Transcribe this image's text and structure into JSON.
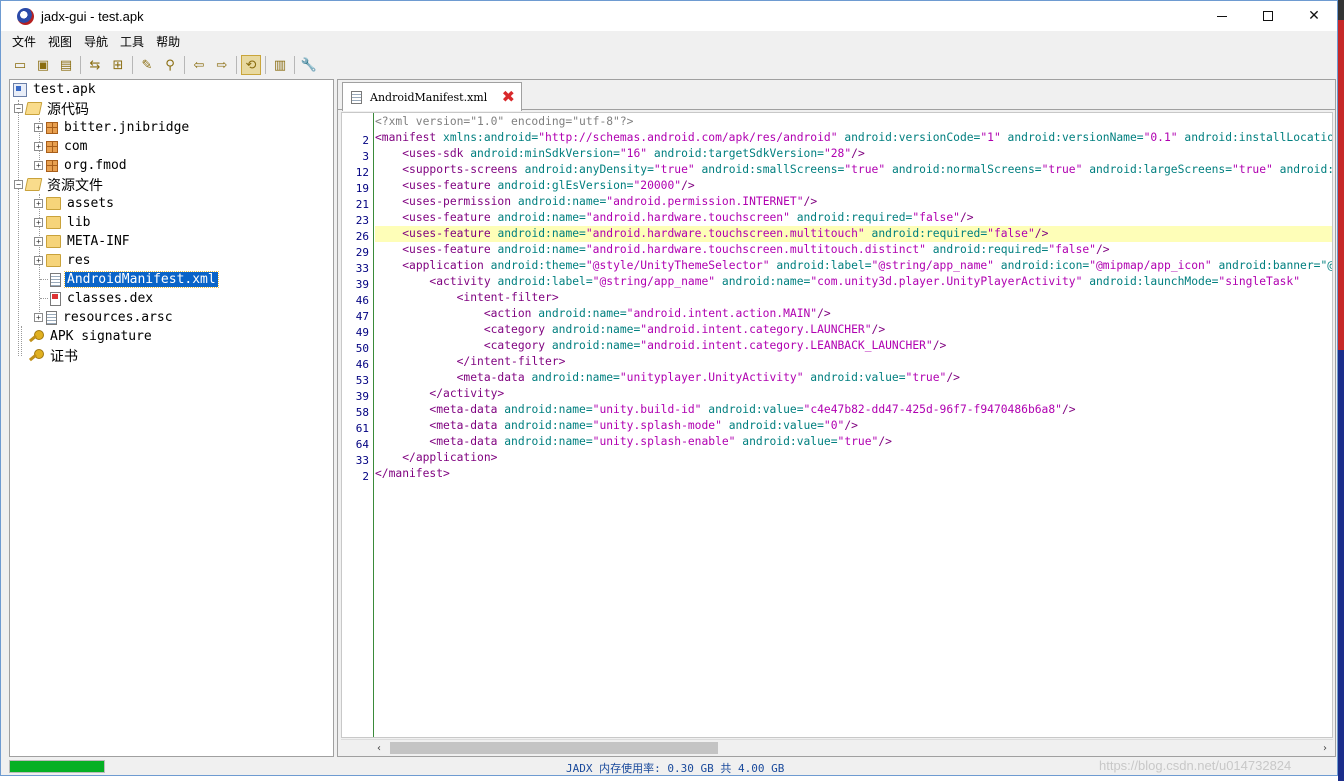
{
  "window": {
    "title": "jadx-gui - test.apk"
  },
  "menu": [
    "文件",
    "视图",
    "导航",
    "工具",
    "帮助"
  ],
  "toolbar_icons": [
    "open-file-icon",
    "save-all-icon",
    "export-icon",
    "sync-icon",
    "flatten-packages-icon",
    "decompile-all-icon",
    "search-icon",
    "back-icon",
    "forward-icon",
    "auto-sync-icon",
    "log-viewer-icon",
    "settings-icon"
  ],
  "tree": {
    "root": "test.apk",
    "source_code": "源代码",
    "packages": [
      "bitter.jnibridge",
      "com",
      "org.fmod"
    ],
    "resources": "资源文件",
    "resource_folders": [
      "assets",
      "lib",
      "META-INF",
      "res"
    ],
    "resource_files": [
      "AndroidManifest.xml",
      "classes.dex",
      "resources.arsc"
    ],
    "apk_signature": "APK signature",
    "certificate": "证书"
  },
  "editor": {
    "tab_label": "AndroidManifest.xml",
    "line_numbers": [
      "",
      "2",
      "3",
      "12",
      "19",
      "21",
      "23",
      "26",
      "29",
      "33",
      "39",
      "46",
      "47",
      "49",
      "50",
      "46",
      "53",
      "39",
      "58",
      "61",
      "64",
      "33",
      "2"
    ],
    "lines": [
      [
        [
          "t-decl",
          "<?xml version=\"1.0\" encoding=\"utf-8\"?>"
        ]
      ],
      [
        [
          "t-tag",
          "<manifest"
        ],
        [
          "t-attr",
          " xmlns:android="
        ],
        [
          "t-val",
          "\"http://schemas.android.com/apk/res/android\""
        ],
        [
          "t-attr",
          " android:versionCode="
        ],
        [
          "t-val",
          "\"1\""
        ],
        [
          "t-attr",
          " android:versionName="
        ],
        [
          "t-val",
          "\"0.1\""
        ],
        [
          "t-attr",
          " android:installLocation=\"preferExternal\""
        ]
      ],
      [
        [
          "",
          "    "
        ],
        [
          "t-tag",
          "<uses-sdk"
        ],
        [
          "t-attr",
          " android:minSdkVersion="
        ],
        [
          "t-val",
          "\"16\""
        ],
        [
          "t-attr",
          " android:targetSdkVersion="
        ],
        [
          "t-val",
          "\"28\""
        ],
        [
          "t-tag",
          "/>"
        ]
      ],
      [
        [
          "",
          "    "
        ],
        [
          "t-tag",
          "<supports-screens"
        ],
        [
          "t-attr",
          " android:anyDensity="
        ],
        [
          "t-val",
          "\"true\""
        ],
        [
          "t-attr",
          " android:smallScreens="
        ],
        [
          "t-val",
          "\"true\""
        ],
        [
          "t-attr",
          " android:normalScreens="
        ],
        [
          "t-val",
          "\"true\""
        ],
        [
          "t-attr",
          " android:largeScreens="
        ],
        [
          "t-val",
          "\"true\""
        ],
        [
          "t-attr",
          " android:xlargeScreens=\"true\""
        ]
      ],
      [
        [
          "",
          "    "
        ],
        [
          "t-tag",
          "<uses-feature"
        ],
        [
          "t-attr",
          " android:glEsVersion="
        ],
        [
          "t-val",
          "\"20000\""
        ],
        [
          "t-tag",
          "/>"
        ]
      ],
      [
        [
          "",
          "    "
        ],
        [
          "t-tag",
          "<uses-permission"
        ],
        [
          "t-attr",
          " android:name="
        ],
        [
          "t-val",
          "\"android.permission.INTERNET\""
        ],
        [
          "t-tag",
          "/>"
        ]
      ],
      [
        [
          "",
          "    "
        ],
        [
          "t-tag",
          "<uses-feature"
        ],
        [
          "t-attr",
          " android:name="
        ],
        [
          "t-val",
          "\"android.hardware.touchscreen\""
        ],
        [
          "t-attr",
          " android:required="
        ],
        [
          "t-val",
          "\"false\""
        ],
        [
          "t-tag",
          "/>"
        ]
      ],
      [
        [
          "",
          "    "
        ],
        [
          "t-tag",
          "<uses-feature"
        ],
        [
          "t-attr",
          " android:name="
        ],
        [
          "t-val",
          "\"android.hardware.touchscreen.multitouch\""
        ],
        [
          "t-attr",
          " android:required="
        ],
        [
          "t-val",
          "\"false\""
        ],
        [
          "t-tag",
          "/>"
        ]
      ],
      [
        [
          "",
          "    "
        ],
        [
          "t-tag",
          "<uses-feature"
        ],
        [
          "t-attr",
          " android:name="
        ],
        [
          "t-val",
          "\"android.hardware.touchscreen.multitouch.distinct\""
        ],
        [
          "t-attr",
          " android:required="
        ],
        [
          "t-val",
          "\"false\""
        ],
        [
          "t-tag",
          "/>"
        ]
      ],
      [
        [
          "",
          "    "
        ],
        [
          "t-tag",
          "<application"
        ],
        [
          "t-attr",
          " android:theme="
        ],
        [
          "t-val",
          "\"@style/UnityThemeSelector\""
        ],
        [
          "t-attr",
          " android:label="
        ],
        [
          "t-val",
          "\"@string/app_name\""
        ],
        [
          "t-attr",
          " android:icon="
        ],
        [
          "t-val",
          "\"@mipmap/app_icon\""
        ],
        [
          "t-attr",
          " android:banner=\"@drawable/app_banner\""
        ]
      ],
      [
        [
          "",
          "        "
        ],
        [
          "t-tag",
          "<activity"
        ],
        [
          "t-attr",
          " android:label="
        ],
        [
          "t-val",
          "\"@string/app_name\""
        ],
        [
          "t-attr",
          " android:name="
        ],
        [
          "t-val",
          "\"com.unity3d.player.UnityPlayerActivity\""
        ],
        [
          "t-attr",
          " android:launchMode="
        ],
        [
          "t-val",
          "\"singleTask\""
        ]
      ],
      [
        [
          "",
          "            "
        ],
        [
          "t-tag",
          "<intent-filter>"
        ]
      ],
      [
        [
          "",
          "                "
        ],
        [
          "t-tag",
          "<action"
        ],
        [
          "t-attr",
          " android:name="
        ],
        [
          "t-val",
          "\"android.intent.action.MAIN\""
        ],
        [
          "t-tag",
          "/>"
        ]
      ],
      [
        [
          "",
          "                "
        ],
        [
          "t-tag",
          "<category"
        ],
        [
          "t-attr",
          " android:name="
        ],
        [
          "t-val",
          "\"android.intent.category.LAUNCHER\""
        ],
        [
          "t-tag",
          "/>"
        ]
      ],
      [
        [
          "",
          "                "
        ],
        [
          "t-tag",
          "<category"
        ],
        [
          "t-attr",
          " android:name="
        ],
        [
          "t-val",
          "\"android.intent.category.LEANBACK_LAUNCHER\""
        ],
        [
          "t-tag",
          "/>"
        ]
      ],
      [
        [
          "",
          "            "
        ],
        [
          "t-tag",
          "</intent-filter>"
        ]
      ],
      [
        [
          "",
          "            "
        ],
        [
          "t-tag",
          "<meta-data"
        ],
        [
          "t-attr",
          " android:name="
        ],
        [
          "t-val",
          "\"unityplayer.UnityActivity\""
        ],
        [
          "t-attr",
          " android:value="
        ],
        [
          "t-val",
          "\"true\""
        ],
        [
          "t-tag",
          "/>"
        ]
      ],
      [
        [
          "",
          "        "
        ],
        [
          "t-tag",
          "</activity>"
        ]
      ],
      [
        [
          "",
          "        "
        ],
        [
          "t-tag",
          "<meta-data"
        ],
        [
          "t-attr",
          " android:name="
        ],
        [
          "t-val",
          "\"unity.build-id\""
        ],
        [
          "t-attr",
          " android:value="
        ],
        [
          "t-val",
          "\"c4e47b82-dd47-425d-96f7-f9470486b6a8\""
        ],
        [
          "t-tag",
          "/>"
        ]
      ],
      [
        [
          "",
          "        "
        ],
        [
          "t-tag",
          "<meta-data"
        ],
        [
          "t-attr",
          " android:name="
        ],
        [
          "t-val",
          "\"unity.splash-mode\""
        ],
        [
          "t-attr",
          " android:value="
        ],
        [
          "t-val",
          "\"0\""
        ],
        [
          "t-tag",
          "/>"
        ]
      ],
      [
        [
          "",
          "        "
        ],
        [
          "t-tag",
          "<meta-data"
        ],
        [
          "t-attr",
          " android:name="
        ],
        [
          "t-val",
          "\"unity.splash-enable\""
        ],
        [
          "t-attr",
          " android:value="
        ],
        [
          "t-val",
          "\"true\""
        ],
        [
          "t-tag",
          "/>"
        ]
      ],
      [
        [
          "",
          "    "
        ],
        [
          "t-tag",
          "</application>"
        ]
      ],
      [
        [
          "t-tag",
          "</manifest>"
        ]
      ]
    ],
    "highlighted_line": 7
  },
  "status": {
    "memory_text": "JADX 内存使用率: 0.30 GB 共 4.00 GB",
    "memory_fraction": 0.075,
    "watermark": "https://blog.csdn.net/u014732824"
  },
  "colors": {
    "selection": "#0a64c8",
    "progress": "#06b025",
    "tag": "#7f007f",
    "attribute": "#007f7f",
    "value": "#b000b0",
    "line_highlight": "#fefeb8"
  }
}
